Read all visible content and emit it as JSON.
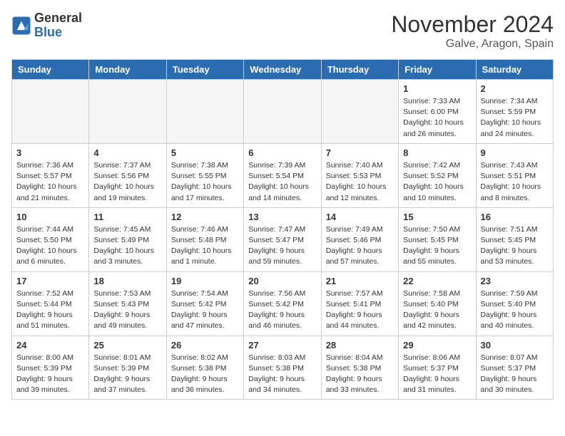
{
  "header": {
    "logo_general": "General",
    "logo_blue": "Blue",
    "month": "November 2024",
    "location": "Galve, Aragon, Spain"
  },
  "days_of_week": [
    "Sunday",
    "Monday",
    "Tuesday",
    "Wednesday",
    "Thursday",
    "Friday",
    "Saturday"
  ],
  "weeks": [
    [
      {
        "day": "",
        "info": ""
      },
      {
        "day": "",
        "info": ""
      },
      {
        "day": "",
        "info": ""
      },
      {
        "day": "",
        "info": ""
      },
      {
        "day": "",
        "info": ""
      },
      {
        "day": "1",
        "info": "Sunrise: 7:33 AM\nSunset: 6:00 PM\nDaylight: 10 hours\nand 26 minutes."
      },
      {
        "day": "2",
        "info": "Sunrise: 7:34 AM\nSunset: 5:59 PM\nDaylight: 10 hours\nand 24 minutes."
      }
    ],
    [
      {
        "day": "3",
        "info": "Sunrise: 7:36 AM\nSunset: 5:57 PM\nDaylight: 10 hours\nand 21 minutes."
      },
      {
        "day": "4",
        "info": "Sunrise: 7:37 AM\nSunset: 5:56 PM\nDaylight: 10 hours\nand 19 minutes."
      },
      {
        "day": "5",
        "info": "Sunrise: 7:38 AM\nSunset: 5:55 PM\nDaylight: 10 hours\nand 17 minutes."
      },
      {
        "day": "6",
        "info": "Sunrise: 7:39 AM\nSunset: 5:54 PM\nDaylight: 10 hours\nand 14 minutes."
      },
      {
        "day": "7",
        "info": "Sunrise: 7:40 AM\nSunset: 5:53 PM\nDaylight: 10 hours\nand 12 minutes."
      },
      {
        "day": "8",
        "info": "Sunrise: 7:42 AM\nSunset: 5:52 PM\nDaylight: 10 hours\nand 10 minutes."
      },
      {
        "day": "9",
        "info": "Sunrise: 7:43 AM\nSunset: 5:51 PM\nDaylight: 10 hours\nand 8 minutes."
      }
    ],
    [
      {
        "day": "10",
        "info": "Sunrise: 7:44 AM\nSunset: 5:50 PM\nDaylight: 10 hours\nand 6 minutes."
      },
      {
        "day": "11",
        "info": "Sunrise: 7:45 AM\nSunset: 5:49 PM\nDaylight: 10 hours\nand 3 minutes."
      },
      {
        "day": "12",
        "info": "Sunrise: 7:46 AM\nSunset: 5:48 PM\nDaylight: 10 hours\nand 1 minute."
      },
      {
        "day": "13",
        "info": "Sunrise: 7:47 AM\nSunset: 5:47 PM\nDaylight: 9 hours\nand 59 minutes."
      },
      {
        "day": "14",
        "info": "Sunrise: 7:49 AM\nSunset: 5:46 PM\nDaylight: 9 hours\nand 57 minutes."
      },
      {
        "day": "15",
        "info": "Sunrise: 7:50 AM\nSunset: 5:45 PM\nDaylight: 9 hours\nand 55 minutes."
      },
      {
        "day": "16",
        "info": "Sunrise: 7:51 AM\nSunset: 5:45 PM\nDaylight: 9 hours\nand 53 minutes."
      }
    ],
    [
      {
        "day": "17",
        "info": "Sunrise: 7:52 AM\nSunset: 5:44 PM\nDaylight: 9 hours\nand 51 minutes."
      },
      {
        "day": "18",
        "info": "Sunrise: 7:53 AM\nSunset: 5:43 PM\nDaylight: 9 hours\nand 49 minutes."
      },
      {
        "day": "19",
        "info": "Sunrise: 7:54 AM\nSunset: 5:42 PM\nDaylight: 9 hours\nand 47 minutes."
      },
      {
        "day": "20",
        "info": "Sunrise: 7:56 AM\nSunset: 5:42 PM\nDaylight: 9 hours\nand 46 minutes."
      },
      {
        "day": "21",
        "info": "Sunrise: 7:57 AM\nSunset: 5:41 PM\nDaylight: 9 hours\nand 44 minutes."
      },
      {
        "day": "22",
        "info": "Sunrise: 7:58 AM\nSunset: 5:40 PM\nDaylight: 9 hours\nand 42 minutes."
      },
      {
        "day": "23",
        "info": "Sunrise: 7:59 AM\nSunset: 5:40 PM\nDaylight: 9 hours\nand 40 minutes."
      }
    ],
    [
      {
        "day": "24",
        "info": "Sunrise: 8:00 AM\nSunset: 5:39 PM\nDaylight: 9 hours\nand 39 minutes."
      },
      {
        "day": "25",
        "info": "Sunrise: 8:01 AM\nSunset: 5:39 PM\nDaylight: 9 hours\nand 37 minutes."
      },
      {
        "day": "26",
        "info": "Sunrise: 8:02 AM\nSunset: 5:38 PM\nDaylight: 9 hours\nand 36 minutes."
      },
      {
        "day": "27",
        "info": "Sunrise: 8:03 AM\nSunset: 5:38 PM\nDaylight: 9 hours\nand 34 minutes."
      },
      {
        "day": "28",
        "info": "Sunrise: 8:04 AM\nSunset: 5:38 PM\nDaylight: 9 hours\nand 33 minutes."
      },
      {
        "day": "29",
        "info": "Sunrise: 8:06 AM\nSunset: 5:37 PM\nDaylight: 9 hours\nand 31 minutes."
      },
      {
        "day": "30",
        "info": "Sunrise: 8:07 AM\nSunset: 5:37 PM\nDaylight: 9 hours\nand 30 minutes."
      }
    ]
  ]
}
